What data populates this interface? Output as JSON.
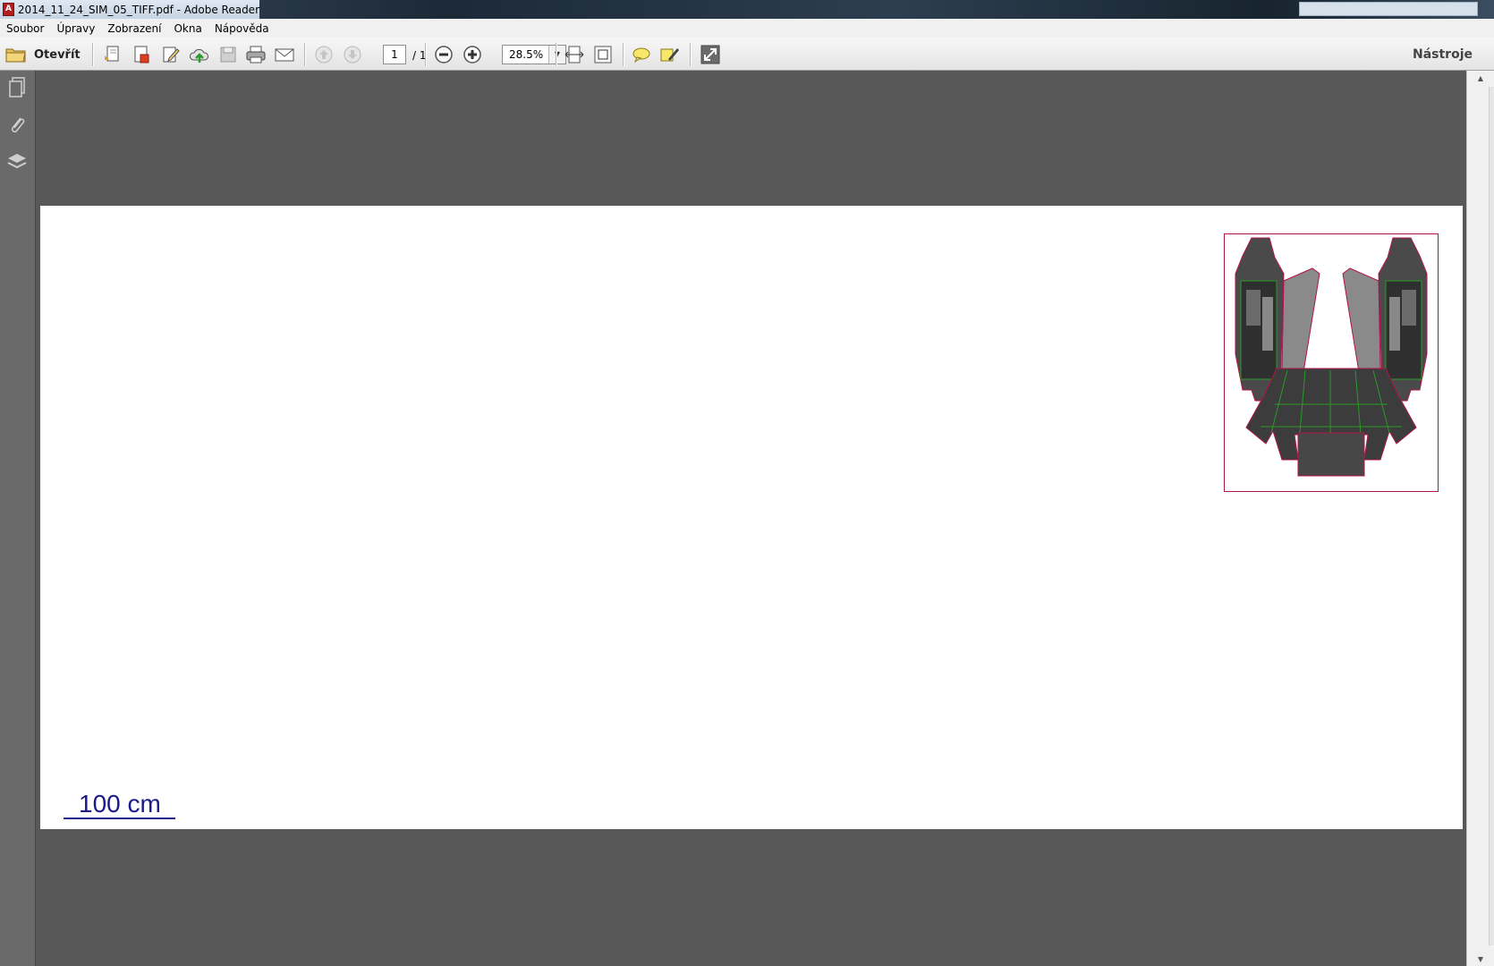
{
  "window": {
    "title": "2014_11_24_SIM_05_TIFF.pdf - Adobe Reader",
    "app_icon": "adobe-reader-icon"
  },
  "menu": {
    "items": [
      {
        "label": "Soubor"
      },
      {
        "label": "Úpravy"
      },
      {
        "label": "Zobrazení"
      },
      {
        "label": "Okna"
      },
      {
        "label": "Nápověda"
      }
    ]
  },
  "toolbar": {
    "open_label": "Otevřít",
    "page_number": "1",
    "page_total": "/ 1",
    "zoom": "28.5%",
    "tools_label": "Nástroje"
  },
  "document": {
    "scale_label": "100 cm"
  },
  "colors": {
    "doc_background": "#585858",
    "page": "#ffffff",
    "scale_text": "#1a1a8a",
    "thumb_border": "#b0144a"
  }
}
